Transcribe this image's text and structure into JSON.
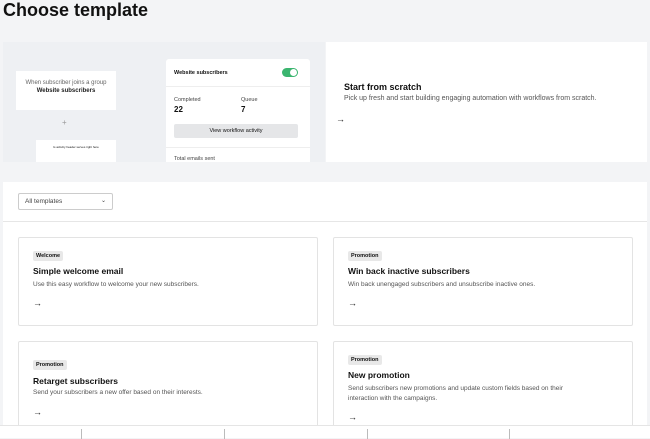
{
  "page": {
    "title": "Choose template"
  },
  "preview": {
    "trigger_prefix": "When subscriber joins a group",
    "trigger_group": "Website subscribers",
    "mini_text": "Is activity header serves right here",
    "workflow_card": {
      "title": "Website subscribers",
      "enabled": true,
      "completed_label": "Completed",
      "completed": "22",
      "queue_label": "Queue",
      "queue": "7",
      "button": "View workflow activity",
      "total_label": "Total emails sent"
    }
  },
  "scratch": {
    "title": "Start from scratch",
    "description": "Pick up fresh and start building engaging automation with workflows from scratch.",
    "arrow": "→"
  },
  "filter": {
    "selected": "All templates"
  },
  "templates": [
    {
      "badge": "Welcome",
      "title": "Simple welcome email",
      "description": "Use this easy workflow to welcome your new subscribers.",
      "arrow": "→"
    },
    {
      "badge": "Promotion",
      "title": "Win back inactive subscribers",
      "description": "Win back unengaged subscribers and unsubscribe inactive ones.",
      "arrow": "→"
    },
    {
      "badge": "Promotion",
      "title": "Retarget subscribers",
      "description": "Send your subscribers a new offer based on their interests.",
      "arrow": "→"
    },
    {
      "badge": "Promotion",
      "title": "New promotion",
      "description": "Send subscribers new promotions and update custom fields based on their interaction with the campaigns.",
      "arrow": "→"
    }
  ],
  "colors": {
    "toggle_on": "#3bb56f",
    "background": "#f3f4f6"
  }
}
